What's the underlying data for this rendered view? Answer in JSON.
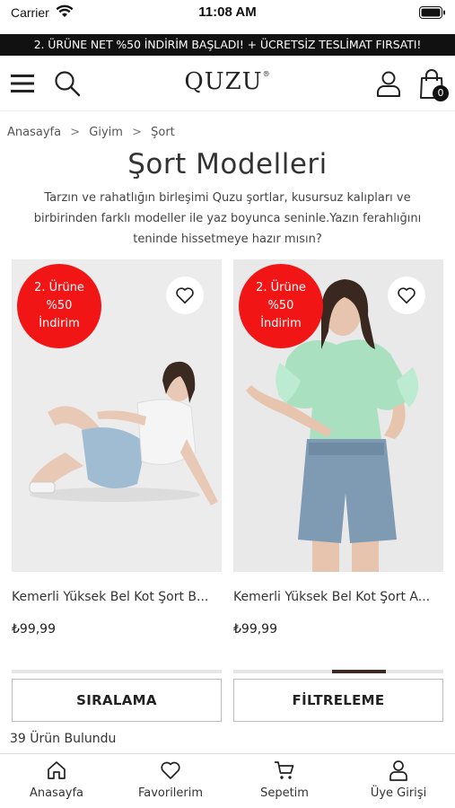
{
  "status_bar": {
    "carrier": "Carrier",
    "time": "11:08 AM"
  },
  "promo_banner": "2. ÜRÜNE NET %50 İNDİRİM BAŞLADI! + ÜCRETSİZ TESLİMAT FIRSATI!",
  "header": {
    "logo": "QUZU",
    "logo_mark": "®",
    "cart_count": "0"
  },
  "breadcrumb": [
    "Anasayfa",
    "Giyim",
    "Şort"
  ],
  "breadcrumb_sep": ">",
  "page_title": "Şort Modelleri",
  "description": "Tarzın ve rahatlığın birleşimi Quzu şortlar, kusursuz kalıpları ve birbirinden farklı modeller ile yaz boyunca seninle.Yazın ferahlığını teninde hissetmeye hazır mısın?",
  "products": [
    {
      "badge_line1": "2. Ürüne",
      "badge_line2": "%50",
      "badge_line3": "İndirim",
      "name": "Kemerli Yüksek Bel Kot Şort B...",
      "price": "₺99,99"
    },
    {
      "badge_line1": "2. Ürüne",
      "badge_line2": "%50",
      "badge_line3": "İndirim",
      "name": "Kemerli Yüksek Bel Kot Şort A...",
      "price": "₺99,99"
    }
  ],
  "actions": {
    "sort": "SIRALAMA",
    "filter": "FİLTRELEME"
  },
  "result_count": "39 Ürün  Bulundu",
  "tab_bar": [
    {
      "label": "Anasayfa",
      "icon": "home-icon"
    },
    {
      "label": "Favorilerim",
      "icon": "heart-icon"
    },
    {
      "label": "Sepetim",
      "icon": "cart-icon"
    },
    {
      "label": "Üye Girişi",
      "icon": "user-icon"
    }
  ],
  "colors": {
    "badge": "#f21515",
    "banner": "#111111",
    "accent": "#222222"
  }
}
